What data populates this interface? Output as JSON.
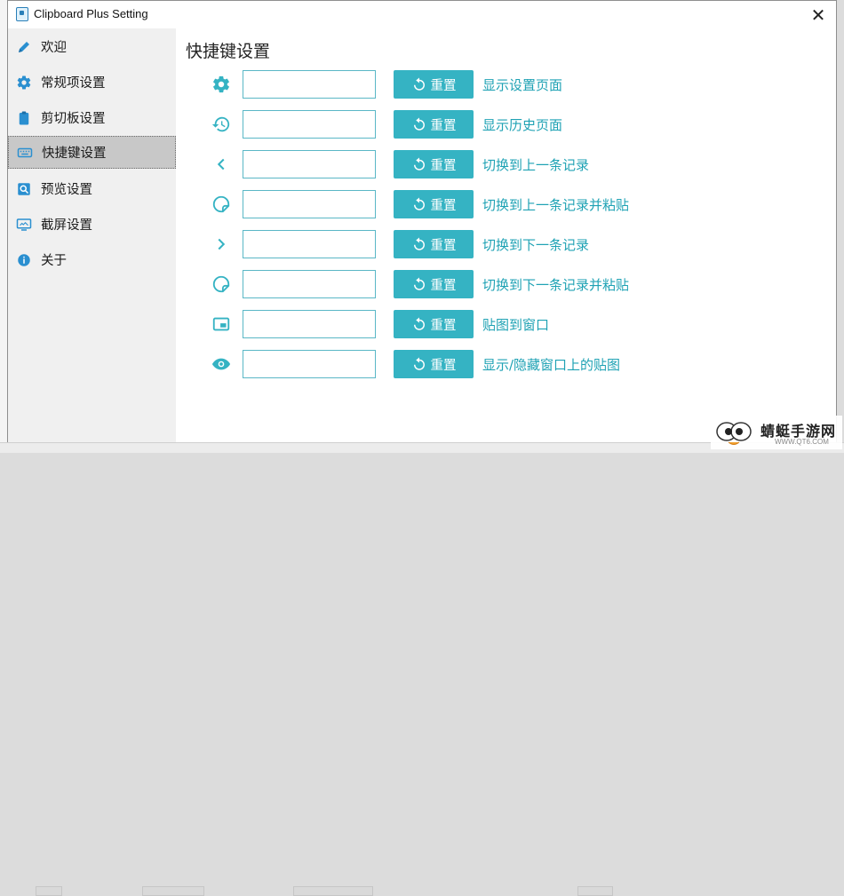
{
  "window": {
    "title": "Clipboard Plus Setting",
    "close_glyph": "✕"
  },
  "sidebar": {
    "items": [
      {
        "label": "欢迎",
        "icon": "pencil-icon",
        "active": false
      },
      {
        "label": "常规项设置",
        "icon": "gear-icon",
        "active": false
      },
      {
        "label": "剪切板设置",
        "icon": "clipboard-icon",
        "active": false
      },
      {
        "label": "快捷键设置",
        "icon": "keyboard-icon",
        "active": true
      },
      {
        "label": "预览设置",
        "icon": "preview-icon",
        "active": false
      },
      {
        "label": "截屏设置",
        "icon": "monitor-icon",
        "active": false
      },
      {
        "label": "关于",
        "icon": "info-icon",
        "active": false
      }
    ]
  },
  "content": {
    "title": "快捷键设置",
    "shortcuts": [
      {
        "icon": "gear-icon",
        "value": "",
        "reset_label": "重置",
        "label": "显示设置页面"
      },
      {
        "icon": "history-icon",
        "value": "",
        "reset_label": "重置",
        "label": "显示历史页面"
      },
      {
        "icon": "chevron-left-icon",
        "value": "",
        "reset_label": "重置",
        "label": "切换到上一条记录"
      },
      {
        "icon": "paste-icon",
        "value": "",
        "reset_label": "重置",
        "label": "切换到上一条记录并粘贴"
      },
      {
        "icon": "chevron-right-icon",
        "value": "",
        "reset_label": "重置",
        "label": "切换到下一条记录"
      },
      {
        "icon": "paste-icon",
        "value": "",
        "reset_label": "重置",
        "label": "切换到下一条记录并粘贴"
      },
      {
        "icon": "pin-window-icon",
        "value": "",
        "reset_label": "重置",
        "label": "贴图到窗口"
      },
      {
        "icon": "eye-icon",
        "value": "",
        "reset_label": "重置",
        "label": "显示/隐藏窗口上的贴图"
      }
    ]
  },
  "watermark": {
    "name": "蜻蜓手游网",
    "url": "WWW.QT6.COM"
  },
  "colors": {
    "accent": "#35b3c3",
    "label": "#1fa2b4",
    "sidebar_icon": "#2a8fd0",
    "sidebar_bg": "#f0f0f0",
    "active_bg": "#c8c8c8"
  }
}
